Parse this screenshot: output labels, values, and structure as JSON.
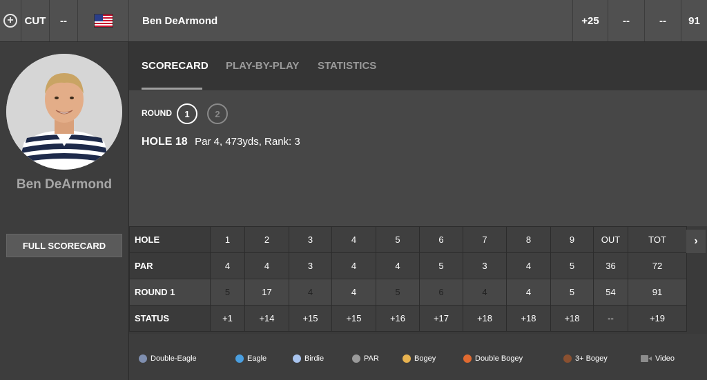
{
  "topbar": {
    "status": "CUT",
    "dash1": "--",
    "player_name": "Ben DeArmond",
    "to_par": "+25",
    "dash2": "--",
    "dash3": "--",
    "total": "91"
  },
  "left": {
    "player_name": "Ben DeArmond",
    "full_scorecard_label": "FULL SCORECARD"
  },
  "tabs": [
    {
      "label": "SCORECARD",
      "active": true
    },
    {
      "label": "PLAY-BY-PLAY",
      "active": false
    },
    {
      "label": "STATISTICS",
      "active": false
    }
  ],
  "round_selector": {
    "label": "ROUND",
    "rounds": [
      "1",
      "2"
    ],
    "selected": "1"
  },
  "hole_info": {
    "title": "HOLE 18",
    "details": "Par 4, 473yds, Rank: 3"
  },
  "scorecard": {
    "rows": [
      {
        "label": "HOLE",
        "cells": [
          "1",
          "2",
          "3",
          "4",
          "5",
          "6",
          "7",
          "8",
          "9",
          "OUT",
          "TOT"
        ]
      },
      {
        "label": "PAR",
        "cells": [
          "4",
          "4",
          "3",
          "4",
          "4",
          "5",
          "3",
          "4",
          "5",
          "36",
          "72"
        ]
      },
      {
        "label": "ROUND 1",
        "cells": [
          "5",
          "17",
          "4",
          "4",
          "5",
          "6",
          "4",
          "4",
          "5",
          "54",
          "91"
        ],
        "result": [
          "bogey",
          "3plus",
          "bogey",
          "par",
          "bogey",
          "bogey",
          "bogey",
          "par",
          "par",
          "",
          ""
        ]
      },
      {
        "label": "STATUS",
        "cells": [
          "+1",
          "+14",
          "+15",
          "+15",
          "+16",
          "+17",
          "+18",
          "+18",
          "+18",
          "--",
          "+19"
        ]
      }
    ]
  },
  "legend": [
    {
      "label": "Double-Eagle",
      "color": "#7f8fb0"
    },
    {
      "label": "Eagle",
      "color": "#4a9fe0"
    },
    {
      "label": "Birdie",
      "color": "#a9c4ee"
    },
    {
      "label": "PAR",
      "color": "#9a9a9a"
    },
    {
      "label": "Bogey",
      "color": "#e8b350"
    },
    {
      "label": "Double Bogey",
      "color": "#e06a30"
    },
    {
      "label": "3+ Bogey",
      "color": "#8a5030"
    },
    {
      "label": "Video",
      "icon": "video-camera-icon"
    }
  ],
  "colors": {
    "bogey": "#e8b350",
    "three_plus_bogey": "#8a5030"
  }
}
